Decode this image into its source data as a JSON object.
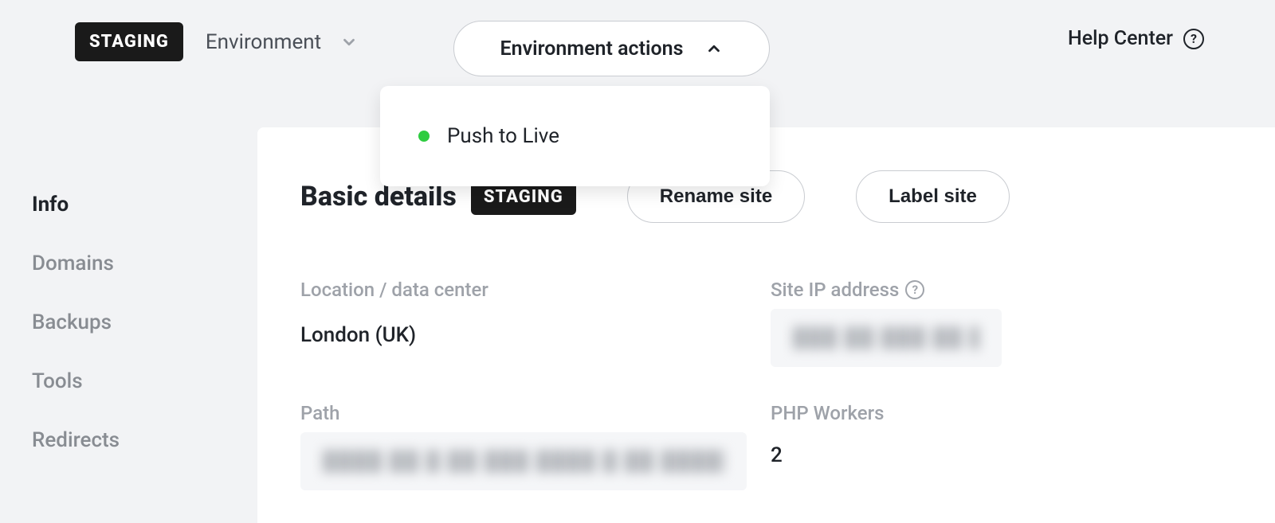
{
  "topbar": {
    "env_badge": "STAGING",
    "env_label": "Environment",
    "actions_label": "Environment actions",
    "dropdown": {
      "items": [
        {
          "label": "Push to Live"
        }
      ]
    },
    "help_label": "Help Center"
  },
  "sidebar": {
    "items": [
      {
        "label": "Info",
        "active": true
      },
      {
        "label": "Domains",
        "active": false
      },
      {
        "label": "Backups",
        "active": false
      },
      {
        "label": "Tools",
        "active": false
      },
      {
        "label": "Redirects",
        "active": false
      }
    ]
  },
  "panel": {
    "title": "Basic details",
    "badge": "STAGING",
    "rename_label": "Rename site",
    "label_site_label": "Label site",
    "fields": {
      "location_label": "Location / data center",
      "location_value": "London (UK)",
      "ip_label": "Site IP address",
      "ip_value": "███ ██ ███ ██  ███ ██",
      "path_label": "Path",
      "path_value": "████ ██ █ ██  ███ ████ █ ██ █████  ███ ███████",
      "php_label": "PHP Workers",
      "php_value": "2"
    }
  }
}
